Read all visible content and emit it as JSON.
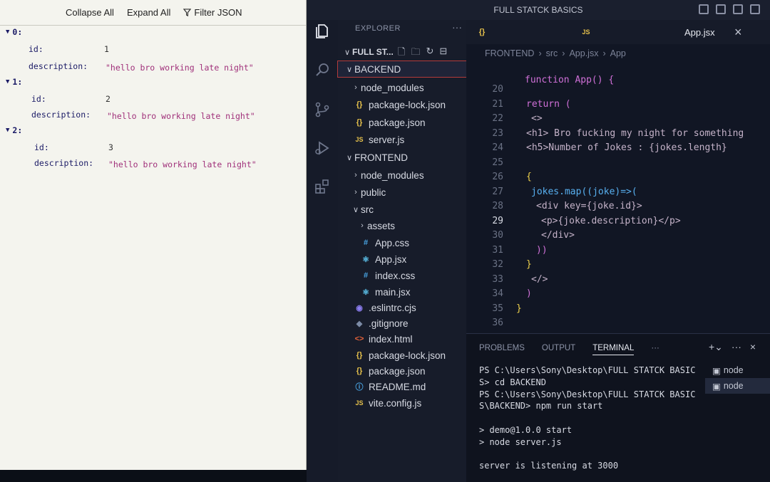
{
  "json_viewer": {
    "toolbar": {
      "collapse": "Collapse All",
      "expand": "Expand All",
      "filter": "Filter JSON"
    },
    "items": [
      {
        "index": "0:",
        "id_key": "id:",
        "id_val": "1",
        "desc_key": "description:",
        "desc_val": "\"hello bro working late night\""
      },
      {
        "index": "1:",
        "id_key": "id:",
        "id_val": "2",
        "desc_key": "description:",
        "desc_val": "\"hello bro working late night\""
      },
      {
        "index": "2:",
        "id_key": "id:",
        "id_val": "3",
        "desc_key": "description:",
        "desc_val": "\"hello bro working late night\""
      }
    ]
  },
  "vscode": {
    "title": "FULL STATCK BASICS",
    "explorer": {
      "header": "EXPLORER",
      "dots": "···",
      "root": "FULL ST...",
      "items": [
        {
          "label": "BACKEND",
          "chev": "∨",
          "icon": ""
        },
        {
          "label": "node_modules",
          "chev": "›",
          "icon": ""
        },
        {
          "label": "package-lock.json",
          "chev": "",
          "icon": "{}"
        },
        {
          "label": "package.json",
          "chev": "",
          "icon": "{}"
        },
        {
          "label": "server.js",
          "chev": "",
          "icon": "JS"
        },
        {
          "label": "FRONTEND",
          "chev": "∨",
          "icon": ""
        },
        {
          "label": "node_modules",
          "chev": "›",
          "icon": ""
        },
        {
          "label": "public",
          "chev": "›",
          "icon": ""
        },
        {
          "label": "src",
          "chev": "∨",
          "icon": ""
        },
        {
          "label": "assets",
          "chev": "›",
          "icon": ""
        },
        {
          "label": "App.css",
          "chev": "",
          "icon": "#"
        },
        {
          "label": "App.jsx",
          "chev": "",
          "icon": "⚛"
        },
        {
          "label": "index.css",
          "chev": "",
          "icon": "#"
        },
        {
          "label": "main.jsx",
          "chev": "",
          "icon": "⚛"
        },
        {
          "label": ".eslintrc.cjs",
          "chev": "",
          "icon": "◉"
        },
        {
          "label": ".gitignore",
          "chev": "",
          "icon": "◆"
        },
        {
          "label": "index.html",
          "chev": "",
          "icon": "<>"
        },
        {
          "label": "package-lock.json",
          "chev": "",
          "icon": "{}"
        },
        {
          "label": "package.json",
          "chev": "",
          "icon": "{}"
        },
        {
          "label": "README.md",
          "chev": "",
          "icon": "ⓘ"
        },
        {
          "label": "vite.config.js",
          "chev": "",
          "icon": "JS"
        }
      ]
    },
    "tabs": {
      "tab1_icon": "{}",
      "tab2_icon": "JS",
      "active": "App.jsx",
      "close": "×"
    },
    "breadcrumbs": [
      "FRONTEND",
      "›",
      "src",
      "›",
      "App.jsx",
      "›",
      "App"
    ],
    "code": {
      "top": "function App() {",
      "lines": [
        {
          "n": "20",
          "t": ""
        },
        {
          "n": "21",
          "t": "return ("
        },
        {
          "n": "22",
          "t": "<>"
        },
        {
          "n": "23",
          "t": "<h1> Bro fucking my night for something"
        },
        {
          "n": "24",
          "t": "<h5>Number of Jokes : {jokes.length}"
        },
        {
          "n": "25",
          "t": ""
        },
        {
          "n": "26",
          "t": "{"
        },
        {
          "n": "27",
          "t": "jokes.map((joke)=>("
        },
        {
          "n": "28",
          "t": "<div key={joke.id}>"
        },
        {
          "n": "29",
          "t": "<p>{joke.description}</p>"
        },
        {
          "n": "30",
          "t": "</div>"
        },
        {
          "n": "31",
          "t": "))"
        },
        {
          "n": "32",
          "t": "}"
        },
        {
          "n": "33",
          "t": "</>"
        },
        {
          "n": "34",
          "t": ")"
        },
        {
          "n": "35",
          "t": "}"
        },
        {
          "n": "36",
          "t": ""
        }
      ]
    },
    "panel": {
      "tabs": [
        "PROBLEMS",
        "OUTPUT",
        "TERMINAL"
      ],
      "more": "···",
      "terminal_lines": [
        "PS C:\\Users\\Sony\\Desktop\\FULL STATCK BASIC",
        "S> cd BACKEND",
        "PS C:\\Users\\Sony\\Desktop\\FULL STATCK BASIC",
        "S\\BACKEND> npm run start",
        "",
        "> demo@1.0.0 start",
        "> node server.js",
        "",
        "server is listening at 3000"
      ],
      "terminals": [
        "node",
        "node"
      ]
    }
  }
}
